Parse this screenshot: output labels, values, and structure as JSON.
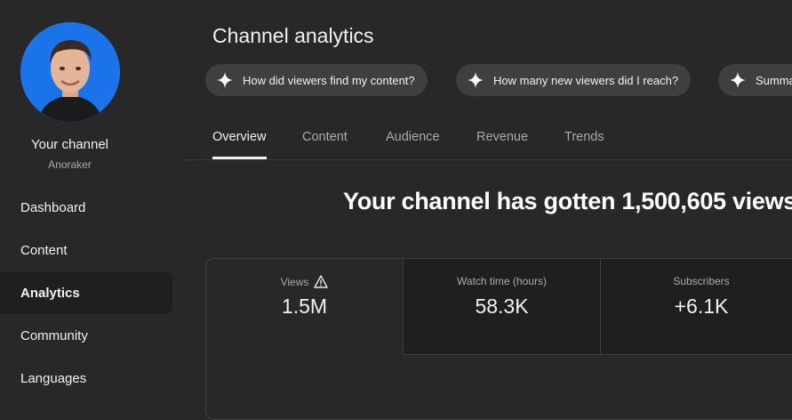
{
  "sidebar": {
    "channel_name": "Your channel",
    "channel_handle": "Anoraker",
    "items": [
      {
        "label": "Dashboard"
      },
      {
        "label": "Content"
      },
      {
        "label": "Analytics",
        "active": true
      },
      {
        "label": "Community"
      },
      {
        "label": "Languages"
      }
    ]
  },
  "header": {
    "title": "Channel analytics"
  },
  "chips": [
    {
      "label": "How did viewers find my content?",
      "icon": "sparkle-icon"
    },
    {
      "label": "How many new viewers did I reach?",
      "icon": "sparkle-icon"
    },
    {
      "label": "Summa",
      "icon": "sparkle-icon"
    }
  ],
  "tabs": [
    {
      "label": "Overview",
      "active": true
    },
    {
      "label": "Content"
    },
    {
      "label": "Audience"
    },
    {
      "label": "Revenue"
    },
    {
      "label": "Trends"
    }
  ],
  "headline": "Your channel has gotten 1,500,605 views",
  "metrics": [
    {
      "label": "Views",
      "value": "1.5M",
      "icon": "warning-icon"
    },
    {
      "label": "Watch time (hours)",
      "value": "58.3K"
    },
    {
      "label": "Subscribers",
      "value": "+6.1K"
    }
  ],
  "colors": {
    "background": "#282828",
    "active_nav": "#1f1f1f",
    "chip": "#3f3f3f",
    "avatar_bg": "#1a73e8"
  }
}
